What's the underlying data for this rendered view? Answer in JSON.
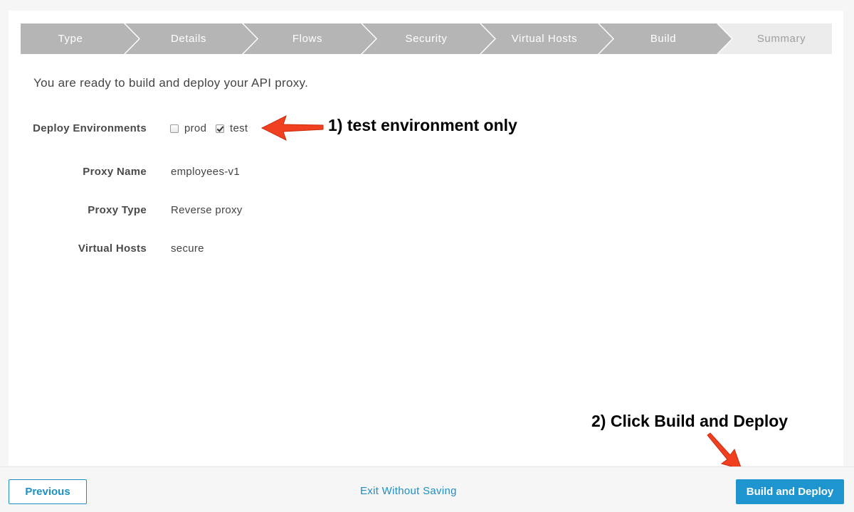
{
  "wizard": {
    "steps": [
      {
        "label": "Type",
        "state": "done"
      },
      {
        "label": "Details",
        "state": "done"
      },
      {
        "label": "Flows",
        "state": "done"
      },
      {
        "label": "Security",
        "state": "done"
      },
      {
        "label": "Virtual Hosts",
        "state": "done"
      },
      {
        "label": "Build",
        "state": "done"
      },
      {
        "label": "Summary",
        "state": "current"
      }
    ]
  },
  "intro": "You are ready to build and deploy your API proxy.",
  "fields": {
    "deploy_environments": {
      "label": "Deploy Environments",
      "options": [
        {
          "label": "prod",
          "checked": false
        },
        {
          "label": "test",
          "checked": true
        }
      ]
    },
    "proxy_name": {
      "label": "Proxy Name",
      "value": "employees-v1"
    },
    "proxy_type": {
      "label": "Proxy Type",
      "value": "Reverse proxy"
    },
    "virtual_hosts": {
      "label": "Virtual Hosts",
      "value": "secure"
    }
  },
  "annotations": {
    "step1": "1) test environment only",
    "step2": "2) Click Build and Deploy"
  },
  "footer": {
    "previous_label": "Previous",
    "exit_label": "Exit Without Saving",
    "deploy_label": "Build and Deploy"
  },
  "colors": {
    "step_done": "#b5b5b5",
    "step_current": "#ececec",
    "accent": "#1f95cf",
    "annotation_arrow": "#f0401f"
  }
}
